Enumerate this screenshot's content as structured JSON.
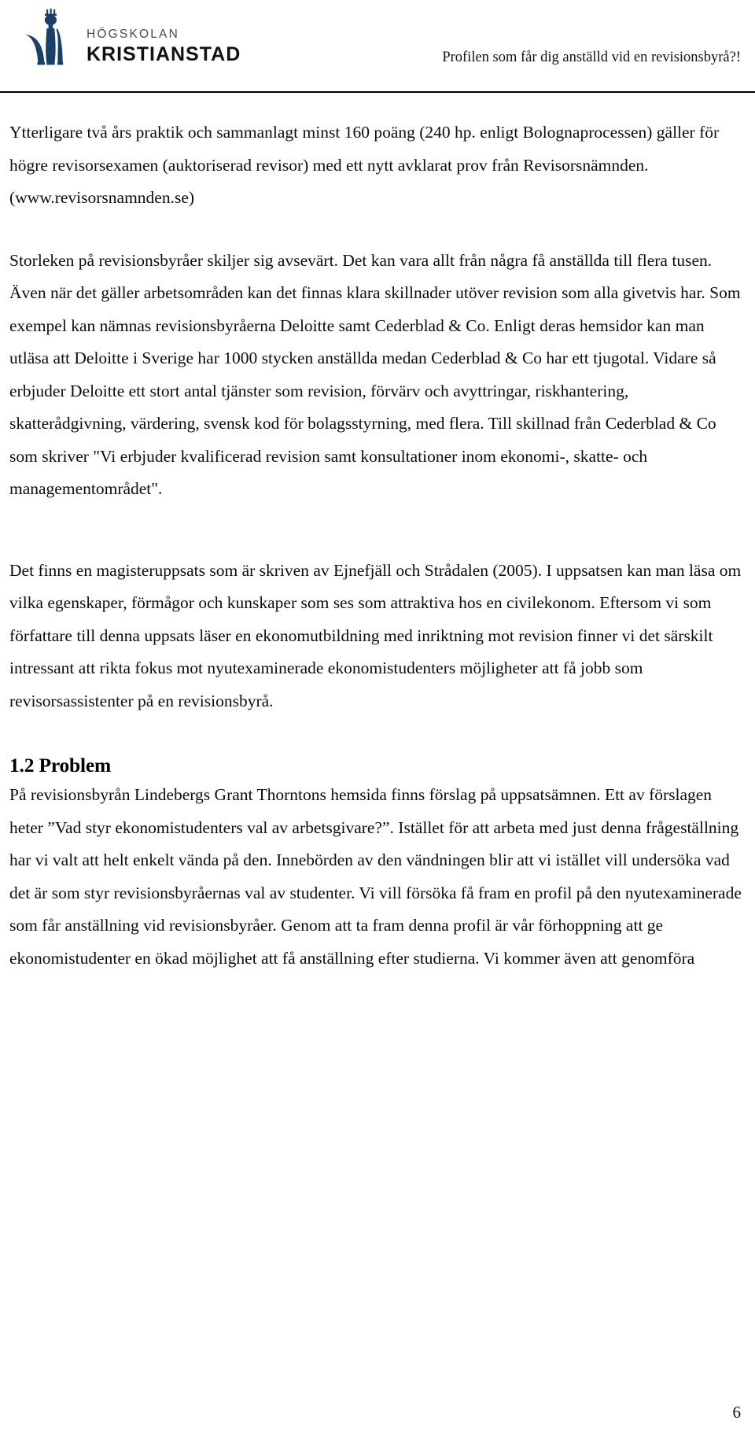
{
  "header": {
    "logo": {
      "line1": "HÖGSKOLAN",
      "line2": "KRISTIANSTAD",
      "mark_color": "#1b3f6b",
      "word1_color": "#4c4c4c",
      "word2_color": "#111111"
    },
    "running_title": "Profilen som får dig anställd vid en revisionsbyrå?!"
  },
  "body": {
    "paragraph_1": "Ytterligare två års praktik och sammanlagt minst 160 poäng (240 hp. enligt Bolognaprocessen) gäller för högre revisorsexamen (auktoriserad revisor) med ett nytt avklarat prov från Revisorsnämnden. (www.revisorsnamnden.se)",
    "paragraph_2": "Storleken på revisionsbyråer skiljer sig avsevärt. Det kan vara allt från några få anställda till flera tusen. Även när det gäller arbetsområden kan det finnas klara skillnader utöver revision som alla givetvis har. Som exempel kan nämnas revisionsbyråerna Deloitte samt Cederblad & Co. Enligt deras hemsidor kan man utläsa att Deloitte i Sverige har 1000 stycken anställda medan Cederblad & Co har ett tjugotal. Vidare så erbjuder Deloitte ett stort antal tjänster som revision, förvärv och avyttringar, riskhantering, skatterådgivning, värdering, svensk kod för bolagsstyrning, med flera. Till skillnad från Cederblad & Co som skriver \"Vi erbjuder kvalificerad revision samt konsultationer inom ekonomi-, skatte- och managementområdet\".",
    "paragraph_3": "Det finns en magisteruppsats som är skriven av Ejnefjäll och Strådalen (2005). I uppsatsen kan man läsa om vilka egenskaper, förmågor och kunskaper som ses som attraktiva hos en civilekonom. Eftersom vi som författare till denna uppsats läser en ekonomutbildning med inriktning mot revision finner vi det särskilt intressant att rikta fokus mot nyutexaminerade ekonomistudenters möjligheter att få jobb som revisorsassistenter på en revisionsbyrå.",
    "section_heading": "1.2 Problem",
    "paragraph_4": "På revisionsbyrån Lindebergs Grant Thorntons hemsida finns förslag på uppsatsämnen. Ett av förslagen heter ”Vad styr ekonomistudenters val av arbetsgivare?”. Istället för att arbeta med just denna frågeställning har vi valt att helt enkelt vända på den. Innebörden av den vändningen blir att vi istället vill undersöka vad det är som styr revisionsbyråernas val av studenter. Vi vill försöka få fram en profil på den nyutexaminerade som får anställning vid revisionsbyråer. Genom att ta fram denna profil är vår förhoppning att ge ekonomistudenter en ökad möjlighet att få anställning efter studierna. Vi kommer även att genomföra"
  },
  "footer": {
    "page_number": "6"
  }
}
